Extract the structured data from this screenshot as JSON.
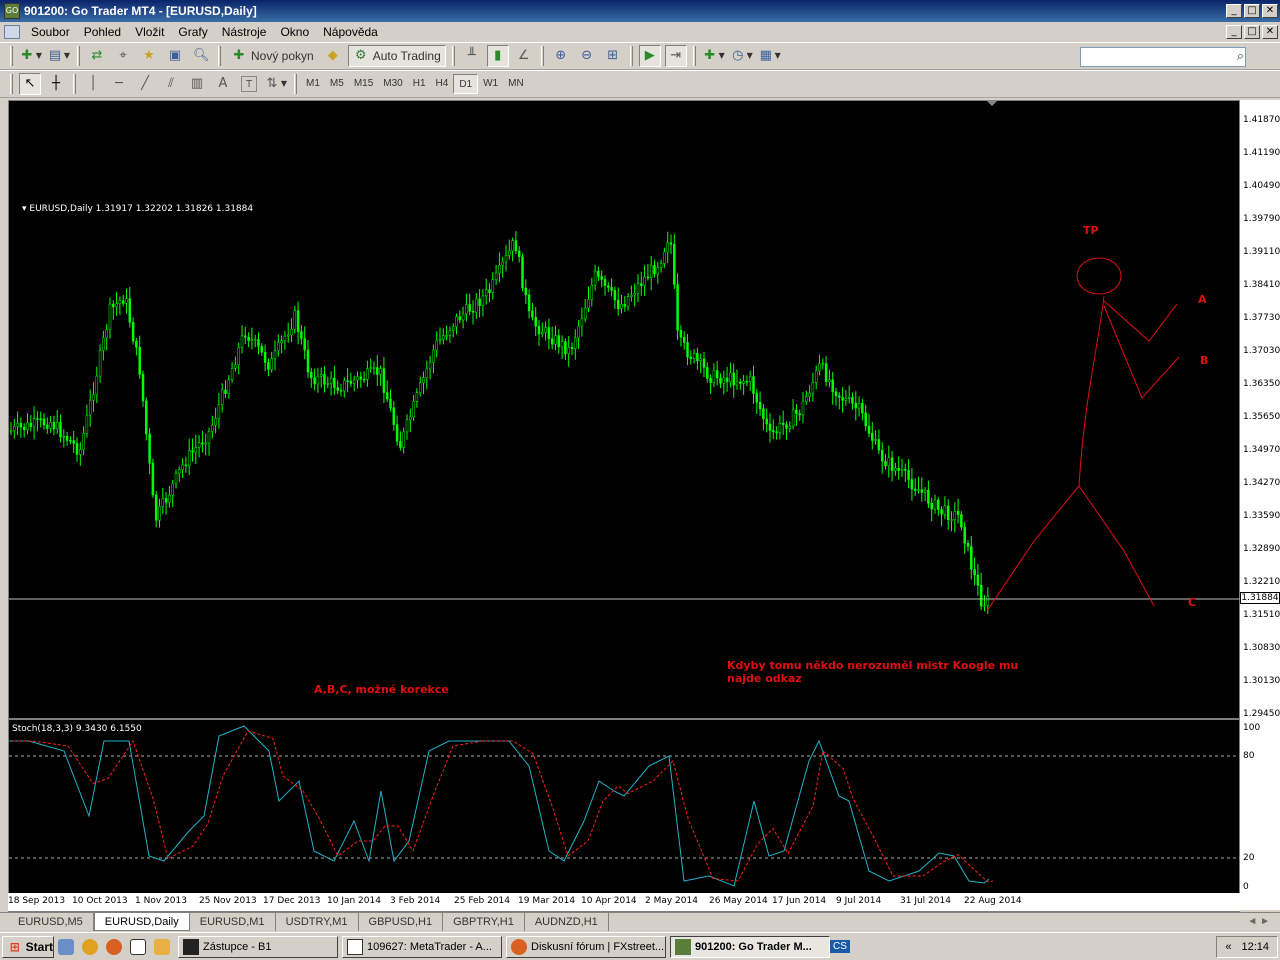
{
  "window": {
    "app_badge": "GO",
    "title": "901200: Go Trader MT4 - [EURUSD,Daily]",
    "minimize": "_",
    "maximize": "□",
    "close": "✕"
  },
  "menu": {
    "items": [
      "Soubor",
      "Pohled",
      "Vložit",
      "Grafy",
      "Nástroje",
      "Okno",
      "Nápověda"
    ]
  },
  "toolbar": {
    "new_order_label": "Nový pokyn",
    "auto_trading_label": "Auto Trading",
    "search_placeholder": "",
    "timeframes": [
      "M1",
      "M5",
      "M15",
      "M30",
      "H1",
      "H4",
      "D1",
      "W1",
      "MN"
    ],
    "active_timeframe": "D1",
    "text_tool": "A",
    "label_tool": "T"
  },
  "chart": {
    "symbol_info": "EURUSD,Daily  1.31917 1.32202 1.31826 1.31884",
    "current_price": "1.31884",
    "price_ticks": [
      "1.41870",
      "1.41190",
      "1.40490",
      "1.39790",
      "1.39110",
      "1.38410",
      "1.37730",
      "1.37030",
      "1.36350",
      "1.35650",
      "1.34970",
      "1.34270",
      "1.33590",
      "1.32890",
      "1.32210",
      "1.31510",
      "1.30830",
      "1.30130",
      "1.29450"
    ],
    "stoch_info": "Stoch(18,3,3) 9.3430 6.1550",
    "stoch_ticks": [
      "100",
      "80",
      "20",
      "0"
    ],
    "date_ticks": [
      "18 Sep 2013",
      "10 Oct 2013",
      "1 Nov 2013",
      "25 Nov 2013",
      "17 Dec 2013",
      "10 Jan 2014",
      "3 Feb 2014",
      "25 Feb 2014",
      "19 Mar 2014",
      "10 Apr 2014",
      "2 May 2014",
      "26 May 2014",
      "17 Jun 2014",
      "9 Jul 2014",
      "31 Jul 2014",
      "22 Aug 2014"
    ],
    "candle_color": "#00ff00",
    "stoch_main_color": "#20b2c8",
    "stoch_signal_color": "#ff2020",
    "annotation_color": "#e01010",
    "annotations": {
      "tp": "TP",
      "a": "A",
      "b": "B",
      "c": "C",
      "abc_note": "A,B,C, možné korekce",
      "note_line1": "Kdyby tomu někdo nerozuměl mistr Koogle mu",
      "note_line2": "najde odkaz"
    }
  },
  "tabs": [
    "EURUSD,M5",
    "EURUSD,Daily",
    "EURUSD,M1",
    "USDTRY,M1",
    "GBPUSD,H1",
    "GBPTRY,H1",
    "AUDNZD,H1"
  ],
  "active_tab": "EURUSD,Daily",
  "tab_scroll": "◄ ►",
  "taskbar": {
    "start_label": "Start",
    "tasks": [
      "Zástupce - B1",
      "109627: MetaTrader - A...",
      "Diskusní fórum | FXstreet...",
      "901200: Go Trader M..."
    ],
    "active_task": "901200: Go Trader M...",
    "language": "CS",
    "tray_arrow": "«",
    "clock": "12:14"
  }
}
